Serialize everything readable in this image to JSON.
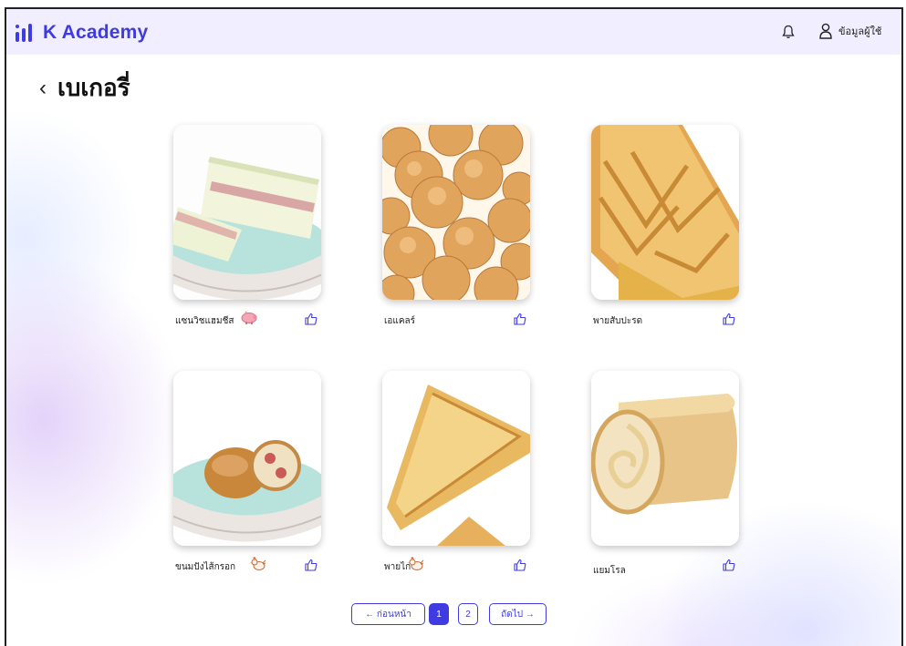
{
  "app": {
    "name": "K Academy"
  },
  "header": {
    "user_label": "ข้อมูลผู้ใช้",
    "icons": [
      "bell-icon",
      "user-icon"
    ]
  },
  "page": {
    "back_icon": "chevron-left-icon",
    "title": "เบเกอรี่"
  },
  "items": [
    {
      "name": "แซนวิชแฮมชีส",
      "tag_icon": "pig-icon",
      "image": "ham-cheese-sandwich"
    },
    {
      "name": "เอแคลร์",
      "tag_icon": "",
      "image": "eclairs"
    },
    {
      "name": "พายสับปะรด",
      "tag_icon": "",
      "image": "pineapple-pie"
    },
    {
      "name": "ขนมปังไส้กรอก",
      "tag_icon": "chicken-icon",
      "image": "sausage-bread"
    },
    {
      "name": "พายไก่",
      "tag_icon": "chicken-icon",
      "image": "chicken-pie"
    },
    {
      "name": "แยมโรล",
      "tag_icon": "",
      "image": "jam-roll"
    }
  ],
  "pagination": {
    "prev_label": "← ก่อนหน้า",
    "next_label": "ถัดไป →",
    "pages": [
      "1",
      "2"
    ],
    "current": "1"
  },
  "colors": {
    "accent": "#3f3be0",
    "topbar": "#f1efff"
  }
}
